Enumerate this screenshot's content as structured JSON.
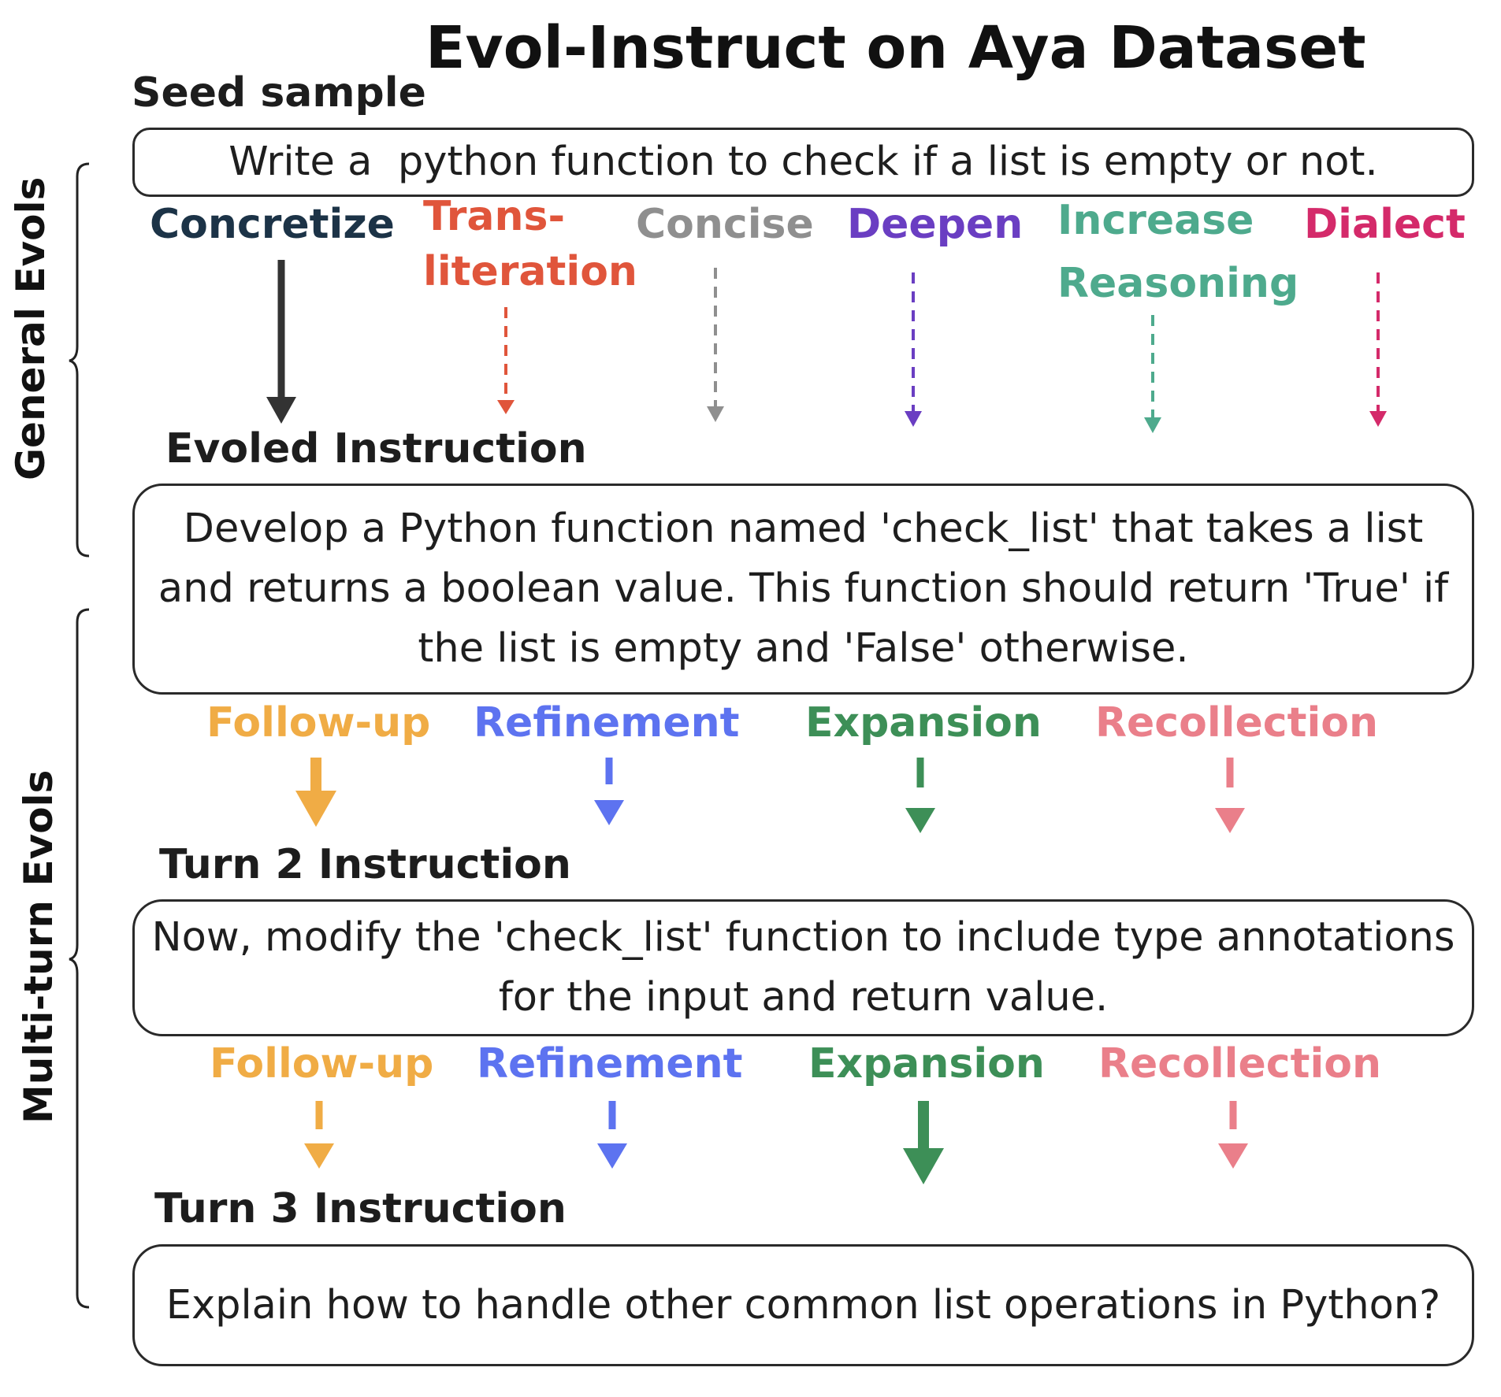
{
  "title": "Evol-Instruct on Aya Dataset",
  "side_labels": {
    "general": "General Evols",
    "multiturn": "Multi-turn Evols"
  },
  "seed": {
    "heading": "Seed sample",
    "text": "Write a  python function to check if a list is empty or not."
  },
  "general_evols": [
    {
      "label": "Concretize",
      "color": "#1c3347",
      "style": "solid"
    },
    {
      "label": "Trans-\nliteration",
      "color": "#e0553b",
      "style": "dashed"
    },
    {
      "label": "Concise",
      "color": "#8f8f8f",
      "style": "dashed"
    },
    {
      "label": "Deepen",
      "color": "#6a3ec2",
      "style": "dashed"
    },
    {
      "label": "Increase\nReasoning",
      "color": "#4eaa8d",
      "style": "dashed"
    },
    {
      "label": "Dialect",
      "color": "#d42a6a",
      "style": "dashed"
    }
  ],
  "evolved": {
    "heading": "Evoled Instruction",
    "text": "Develop a Python function named 'check_list' that takes a list and returns a boolean value. This function should return 'True' if the list is empty and 'False' otherwise."
  },
  "multiturn_row1": [
    {
      "label": "Follow-up",
      "color": "#f0ac45",
      "style": "solid"
    },
    {
      "label": "Refinement",
      "color": "#5d73f0",
      "style": "dashed"
    },
    {
      "label": "Expansion",
      "color": "#3d8f57",
      "style": "dashed"
    },
    {
      "label": "Recollection",
      "color": "#ea7f8a",
      "style": "dashed"
    }
  ],
  "turn2": {
    "heading": "Turn 2 Instruction",
    "text": "Now, modify the 'check_list' function to include type annotations for the input and return value."
  },
  "multiturn_row2": [
    {
      "label": "Follow-up",
      "color": "#f0ac45",
      "style": "dashed"
    },
    {
      "label": "Refinement",
      "color": "#5d73f0",
      "style": "dashed"
    },
    {
      "label": "Expansion",
      "color": "#3d8f57",
      "style": "solid"
    },
    {
      "label": "Recollection",
      "color": "#ea7f8a",
      "style": "dashed"
    }
  ],
  "turn3": {
    "heading": "Turn 3 Instruction",
    "text": "Explain how to handle other common list operations in Python?"
  },
  "colors": {
    "text": "#1e1e1e",
    "border": "#2a2a2a"
  }
}
